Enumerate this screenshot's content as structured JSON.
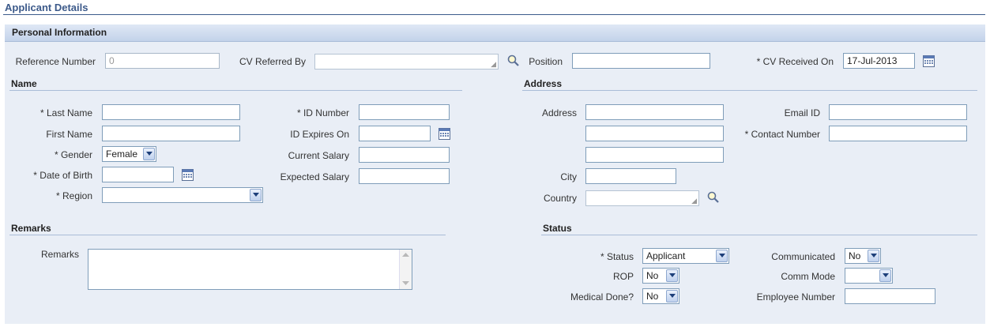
{
  "page_title": "Applicant Details",
  "panel_title": "Personal Information",
  "top_row": {
    "reference_number_label": "Reference Number",
    "reference_number_value": "0",
    "cv_referred_by_label": "CV Referred By",
    "cv_referred_by_value": "",
    "position_label": "Position",
    "position_value": "",
    "cv_received_on_label": "* CV Received On",
    "cv_received_on_value": "17-Jul-2013"
  },
  "name_section": {
    "title": "Name",
    "last_name_label": "* Last Name",
    "first_name_label": "First Name",
    "gender_label": "* Gender",
    "gender_value": "Female",
    "dob_label": "* Date of Birth",
    "region_label": "* Region",
    "region_value": "",
    "id_number_label": "* ID Number",
    "id_expires_label": "ID Expires On",
    "current_salary_label": "Current Salary",
    "expected_salary_label": "Expected Salary"
  },
  "address_section": {
    "title": "Address",
    "address_label": "Address",
    "city_label": "City",
    "country_label": "Country",
    "email_label": "Email ID",
    "contact_label": "* Contact Number"
  },
  "remarks_section": {
    "title": "Remarks",
    "remarks_label": "Remarks"
  },
  "status_section": {
    "title": "Status",
    "status_label": "* Status",
    "status_value": "Applicant",
    "rop_label": "ROP",
    "rop_value": "No",
    "medical_label": "Medical Done?",
    "medical_value": "No",
    "communicated_label": "Communicated",
    "communicated_value": "No",
    "comm_mode_label": "Comm Mode",
    "comm_mode_value": "",
    "employee_number_label": "Employee Number"
  },
  "colors": {
    "title": "#3c5a8a",
    "panel_bg": "#e9eef6",
    "header_top": "#dfe8f5",
    "header_bottom": "#c3d3ea"
  },
  "icons": [
    "search-icon",
    "calendar-icon",
    "chevron-down-icon"
  ]
}
